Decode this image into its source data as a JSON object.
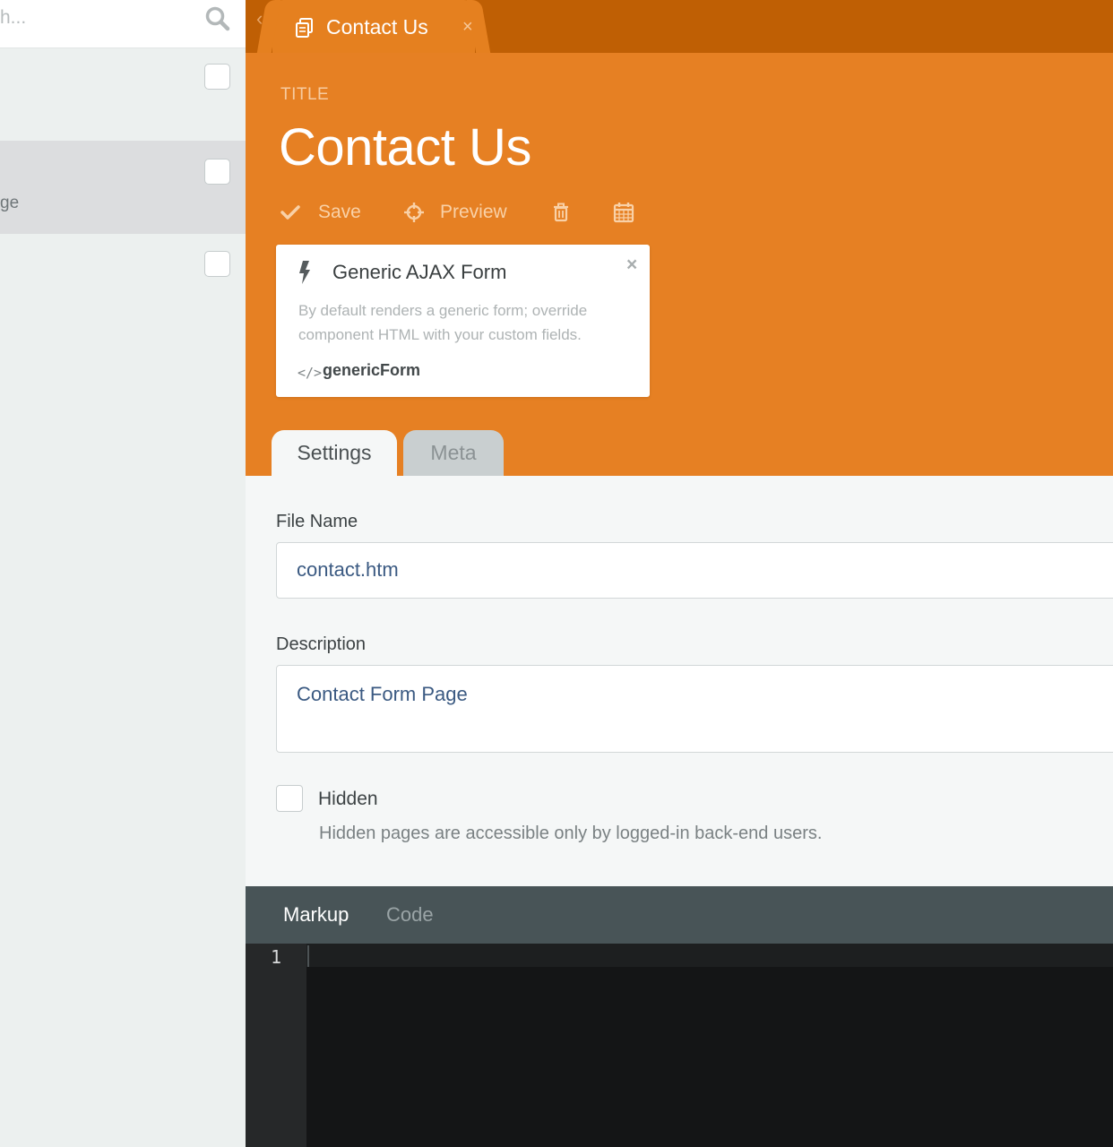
{
  "sidebar": {
    "search": {
      "placeholder_visible": "h..."
    },
    "items": [
      {
        "sub": ""
      },
      {
        "sub": "ge",
        "selected": true
      },
      {
        "sub": ""
      }
    ]
  },
  "tabs": {
    "document_tab": {
      "label": "Contact Us",
      "close": "×"
    }
  },
  "header": {
    "title_label": "TITLE",
    "title_value": "Contact Us"
  },
  "toolbar": {
    "save_label": "Save",
    "preview_label": "Preview"
  },
  "component": {
    "title": "Generic AJAX Form",
    "description": "By default renders a generic form; override component HTML with your custom fields.",
    "code_icon": "</>",
    "code": "genericForm",
    "close": "×"
  },
  "form_tabs": [
    {
      "label": "Settings",
      "active": true
    },
    {
      "label": "Meta",
      "active": false
    }
  ],
  "form": {
    "file_name": {
      "label": "File Name",
      "value": "contact.htm"
    },
    "description": {
      "label": "Description",
      "value": "Contact Form Page"
    },
    "hidden": {
      "label": "Hidden",
      "help": "Hidden pages are accessible only by logged-in back-end users.",
      "checked": false
    }
  },
  "code_tabs": [
    {
      "label": "Markup",
      "active": true
    },
    {
      "label": "Code",
      "active": false
    }
  ],
  "editor": {
    "line_numbers": [
      "1"
    ]
  },
  "colors": {
    "accent": "#e68023",
    "tabbar": "#bf5f04",
    "sidebar": "#ecf0ef",
    "editor_bg": "#141516"
  }
}
